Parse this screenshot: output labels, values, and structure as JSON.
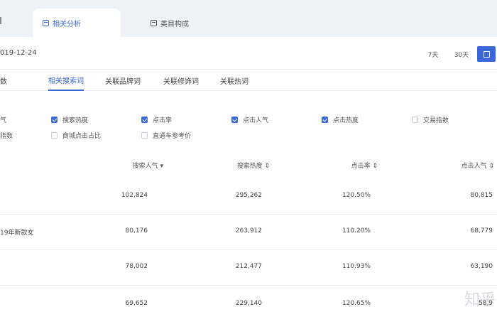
{
  "tabs": [
    {
      "label": "相关分析",
      "active": true
    },
    {
      "label": "类目构成",
      "active": false
    }
  ],
  "date_bar": {
    "date": "019-12-24",
    "range_7": "7天",
    "range_30": "30天"
  },
  "subnav": {
    "left_stub": "数",
    "items": [
      "相关搜索词",
      "关联品牌词",
      "关联修饰词",
      "关联热词"
    ]
  },
  "filters": {
    "row1": [
      {
        "label": "气",
        "checked": false
      },
      {
        "label": "搜索热度",
        "checked": true
      },
      {
        "label": "点击率",
        "checked": true
      },
      {
        "label": "点击人气",
        "checked": true
      },
      {
        "label": "点击热度",
        "checked": true
      },
      {
        "label": "交易指数",
        "checked": false
      }
    ],
    "row2": [
      {
        "label": "指数",
        "checked": false
      },
      {
        "label": "商城点击占比",
        "checked": false
      },
      {
        "label": "直通车参考价",
        "checked": false
      }
    ]
  },
  "table": {
    "headers": [
      "搜索人气 ▾",
      "搜索热度 ⇕",
      "点击率 ⇕",
      "点击人气 ⇕"
    ],
    "rows": [
      {
        "name": "",
        "search_pop": "102,824",
        "search_heat": "295,262",
        "ctr": "120.50%",
        "click_pop": "80,815"
      },
      {
        "name": "19年新款女",
        "search_pop": "80,176",
        "search_heat": "263,912",
        "ctr": "110.20%",
        "click_pop": "68,779"
      },
      {
        "name": "",
        "search_pop": "78,002",
        "search_heat": "212,477",
        "ctr": "110.93%",
        "click_pop": "63,190"
      },
      {
        "name": "",
        "search_pop": "69,652",
        "search_heat": "229,140",
        "ctr": "120.65%",
        "click_pop": "58,9"
      }
    ]
  },
  "watermark": "知乎",
  "colors": {
    "accent": "#3a68d8",
    "topbar": "#eef1f6"
  }
}
